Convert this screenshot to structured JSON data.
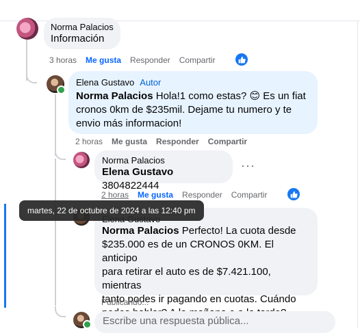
{
  "comment1": {
    "author": "Norma Palacios",
    "text": "Información",
    "time": "3 horas",
    "like": "Me gusta",
    "reply": "Responder",
    "share": "Compartir"
  },
  "comment2": {
    "author": "Elena Gustavo",
    "badge": "Autor",
    "mention": "Norma Palacios",
    "text_line1": " Hola!1 como estas? 😊 Es un fiat",
    "text_line2": "cronos 0km de $235mil. Dejame tu numero y te",
    "text_line3": "envio más informacion!",
    "time": "2 horas",
    "like": "Me gusta",
    "reply": "Responder",
    "share": "Compartir"
  },
  "comment3": {
    "author": "Norma Palacios",
    "mention": "Elena Gustavo",
    "text": " 3804822444",
    "time": "2 horas",
    "like": "Me gusta",
    "reply": "Responder",
    "share": "Compartir",
    "more": "···"
  },
  "comment4": {
    "author": "Elena Gustavo",
    "mention": "Norma Palacios",
    "text_line1": " Perfecto! La cuota desde",
    "text_line2": "$235.000 es de un CRONOS 0KM. El anticipo",
    "text_line3": "para retirar el auto es de $7.421.100, mientras",
    "text_line4": "tanto podes ir pagando en cuotas. Cuándo",
    "text_line5": "podes hablar? A la mañana o a la tarde?",
    "status": "Publicando..."
  },
  "tooltip": "martes, 22 de octubre de 2024 a las 12:40 pm",
  "reply_box": {
    "placeholder": "Escribe una respuesta pública..."
  },
  "colors": {
    "accent": "#1877f2",
    "bubble": "#f0f2f5",
    "highlight": "#e7f3ff",
    "tooltip": "#282828"
  }
}
